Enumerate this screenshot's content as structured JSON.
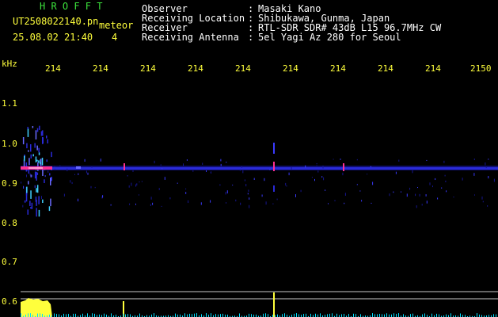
{
  "header": {
    "program": "H R O F F T",
    "filename": "UT2508022140.pn",
    "detect_type": "meteor",
    "date_time": "25.08.02 21:40",
    "count": "4",
    "observer_label": "Observer",
    "observer_value": "Masaki Kano",
    "location_label": "Receiving Location",
    "location_value": "Shibukawa, Gunma, Japan",
    "receiver_label": "Receiver",
    "receiver_value": "RTL-SDR SDR# 43dB L15 96.7MHz CW",
    "antenna_label": "Receiving Antenna",
    "antenna_value": "5el Yagi Az 280 for Seoul",
    "separator": ":"
  },
  "axes": {
    "y_unit": "kHz",
    "y_ticks": [
      "1.1",
      "1.0",
      "0.9",
      "0.8",
      "0.7",
      "0.6"
    ],
    "x_ticks": [
      "214",
      "214",
      "214",
      "214",
      "214",
      "214",
      "214",
      "214",
      "214",
      "2150"
    ]
  },
  "colors": {
    "background": "#000000",
    "label_yellow": "#ffff3c",
    "title_green": "#3ce43c",
    "signal_band": "#3030ff",
    "hot": "#ff3090",
    "marker_line": "#c8c8c8",
    "spectrum": "#00e0ff"
  }
}
